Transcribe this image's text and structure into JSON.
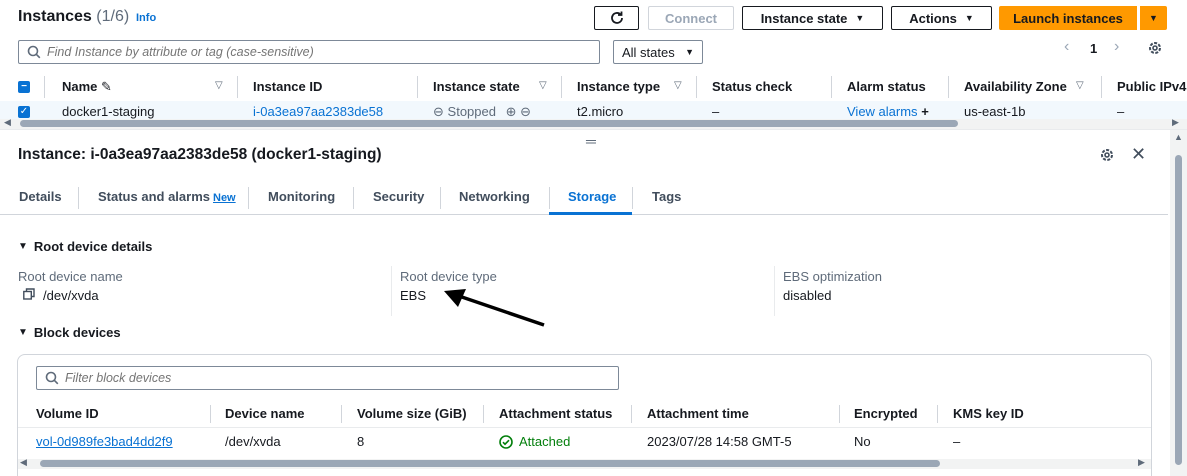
{
  "header": {
    "title": "Instances",
    "count": "(1/6)",
    "info": "Info",
    "refresh_icon": "refresh-icon",
    "connect": "Connect",
    "instance_state": "Instance state",
    "actions": "Actions",
    "launch": "Launch instances"
  },
  "search": {
    "placeholder": "Find Instance by attribute or tag (case-sensitive)"
  },
  "states_filter": {
    "value": "All states"
  },
  "pagination": {
    "page": "1"
  },
  "table": {
    "columns": [
      "Name",
      "Instance ID",
      "Instance state",
      "Instance type",
      "Status check",
      "Alarm status",
      "Availability Zone",
      "Public IPv4"
    ],
    "row": {
      "name": "docker1-staging",
      "instance_id": "i-0a3ea97aa2383de58",
      "state": "Stopped",
      "type": "t2.micro",
      "status_check": "–",
      "alarm": "View alarms",
      "az": "us-east-1b",
      "ipv4": "–"
    }
  },
  "detail": {
    "title": "Instance: i-0a3ea97aa2383de58 (docker1-staging)",
    "tabs": [
      "Details",
      "Status and alarms",
      "Monitoring",
      "Security",
      "Networking",
      "Storage",
      "Tags"
    ],
    "new_badge": "New",
    "active_tab": "Storage",
    "root_section": "Root device details",
    "root_name_label": "Root device name",
    "root_name_value": "/dev/xvda",
    "root_type_label": "Root device type",
    "root_type_value": "EBS",
    "ebs_opt_label": "EBS optimization",
    "ebs_opt_value": "disabled",
    "block_section": "Block devices",
    "filter_placeholder": "Filter block devices",
    "block_columns": [
      "Volume ID",
      "Device name",
      "Volume size (GiB)",
      "Attachment status",
      "Attachment time",
      "Encrypted",
      "KMS key ID"
    ],
    "block_row": {
      "volume_id": "vol-0d989fe3bad4dd2f9",
      "device": "/dev/xvda",
      "size": "8",
      "status": "Attached",
      "time": "2023/07/28 14:58 GMT-5",
      "encrypted": "No",
      "kms": "–"
    }
  },
  "colors": {
    "accent": "#0972d3",
    "primary_button": "#ff9900",
    "success": "#037f0c"
  }
}
